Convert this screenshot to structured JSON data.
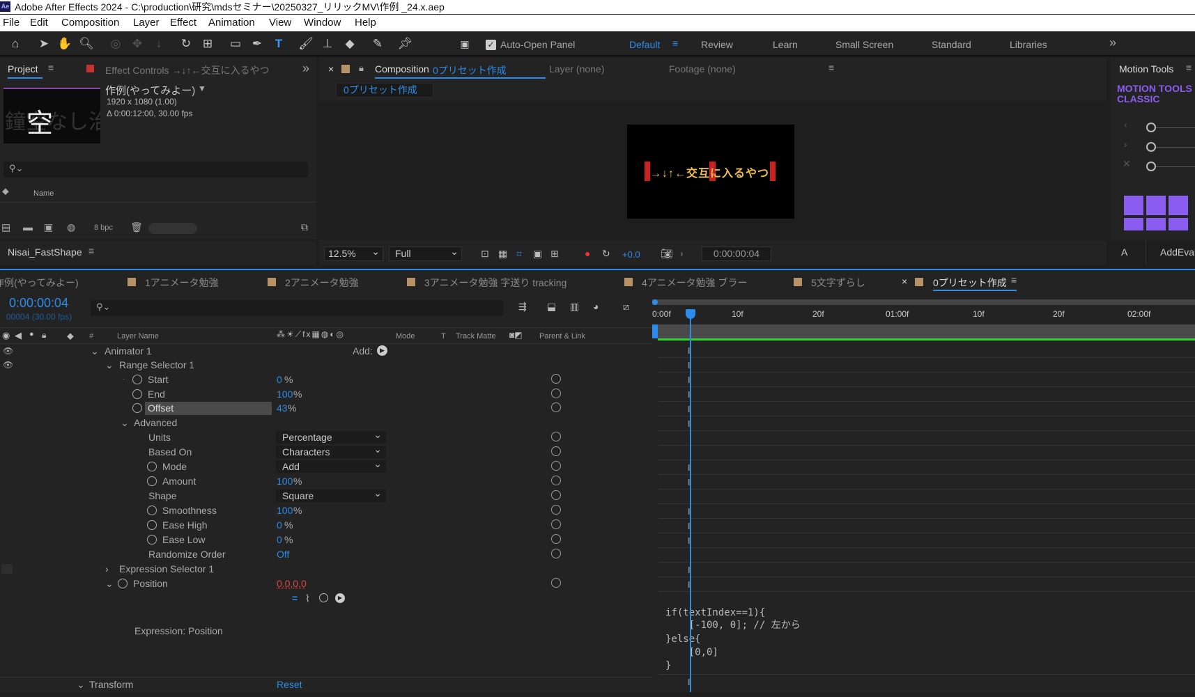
{
  "window": {
    "title": "Adobe After Effects 2024 - C:\\production\\研究\\mdsセミナー\\20250327_リリックMV\\作例 _24.x.aep",
    "app_icon": "Ae"
  },
  "menu": [
    "File",
    "Edit",
    "Composition",
    "Layer",
    "Effect",
    "Animation",
    "View",
    "Window",
    "Help"
  ],
  "toolbar": {
    "auto_open_panel": "Auto-Open Panel",
    "workspaces": [
      "Default",
      "Review",
      "Learn",
      "Small Screen",
      "Standard",
      "Libraries"
    ],
    "active_workspace": "Default",
    "overflow": "»"
  },
  "project": {
    "tab": "Project",
    "effect_controls_tab": "Effect Controls →↓↑←交互に入るやつ",
    "item_name": "作例(やってみよー)",
    "item_size": "1920 x 1080 (1.00)",
    "item_duration": "Δ 0:00:12:00, 30.00 fps",
    "thumb_char": "空",
    "name_col": "Name",
    "bpc": "8 bpc"
  },
  "nisai": {
    "tab": "Nisai_FastShape"
  },
  "composition": {
    "tab_label": "Composition",
    "comp_name": "0プリセット作成",
    "layer_tab": "Layer  (none)",
    "footage_tab": "Footage  (none)",
    "flow_label": "0プリセット作成",
    "preview_text": "→↓↑←交互に入るやつ",
    "zoom": "12.5%",
    "resolution": "Full",
    "exposure": "+0.0",
    "timecode": "0:00:00:04"
  },
  "motion_tools": {
    "tab": "Motion Tools",
    "logo_line1": "MOTION TOOLS",
    "logo_line2": "CLASSIC",
    "bottom_a": "A",
    "bottom_addeval": "AddEval"
  },
  "timeline_tabs": [
    "作例(やってみよー)",
    "1アニメータ勉強",
    "2アニメータ勉強",
    "3アニメータ勉強 字送り  tracking",
    "4アニメータ勉強 ブラー",
    "5文字ずらし",
    "0プリセット作成"
  ],
  "timeline": {
    "timecode": "0:00:00:04",
    "frame_info": "00004 (30.00 fps)",
    "col_hash": "#",
    "col_layer_name": "Layer Name",
    "col_mode": "Mode",
    "col_t": "T",
    "col_track_matte": "Track Matte",
    "col_parent": "Parent & Link",
    "ruler": [
      "0:00f",
      "10f",
      "20f",
      "01:00f",
      "10f",
      "20f",
      "02:00f"
    ]
  },
  "layers": {
    "animator": "Animator 1",
    "add": "Add:",
    "range_selector": "Range Selector 1",
    "start": {
      "label": "Start",
      "value": "0",
      "unit": "%"
    },
    "end": {
      "label": "End",
      "value": "100",
      "unit": "%"
    },
    "offset": {
      "label": "Offset",
      "value": "43",
      "unit": "%"
    },
    "advanced": "Advanced",
    "units": {
      "label": "Units",
      "value": "Percentage"
    },
    "based_on": {
      "label": "Based On",
      "value": "Characters"
    },
    "mode": {
      "label": "Mode",
      "value": "Add"
    },
    "amount": {
      "label": "Amount",
      "value": "100",
      "unit": "%"
    },
    "shape": {
      "label": "Shape",
      "value": "Square"
    },
    "smoothness": {
      "label": "Smoothness",
      "value": "100",
      "unit": "%"
    },
    "ease_high": {
      "label": "Ease High",
      "value": "0",
      "unit": "%"
    },
    "ease_low": {
      "label": "Ease Low",
      "value": "0",
      "unit": "%"
    },
    "randomize": {
      "label": "Randomize Order",
      "value": "Off"
    },
    "expression_selector": "Expression Selector 1",
    "position": {
      "label": "Position",
      "value": "0.0,0.0"
    },
    "expression_label": "Expression: Position",
    "transform": "Transform",
    "reset": "Reset"
  },
  "expression_code": [
    "if(textIndex==1){",
    "    [-100, 0]; // 左から",
    "}else{",
    "    [0,0]",
    "}"
  ]
}
